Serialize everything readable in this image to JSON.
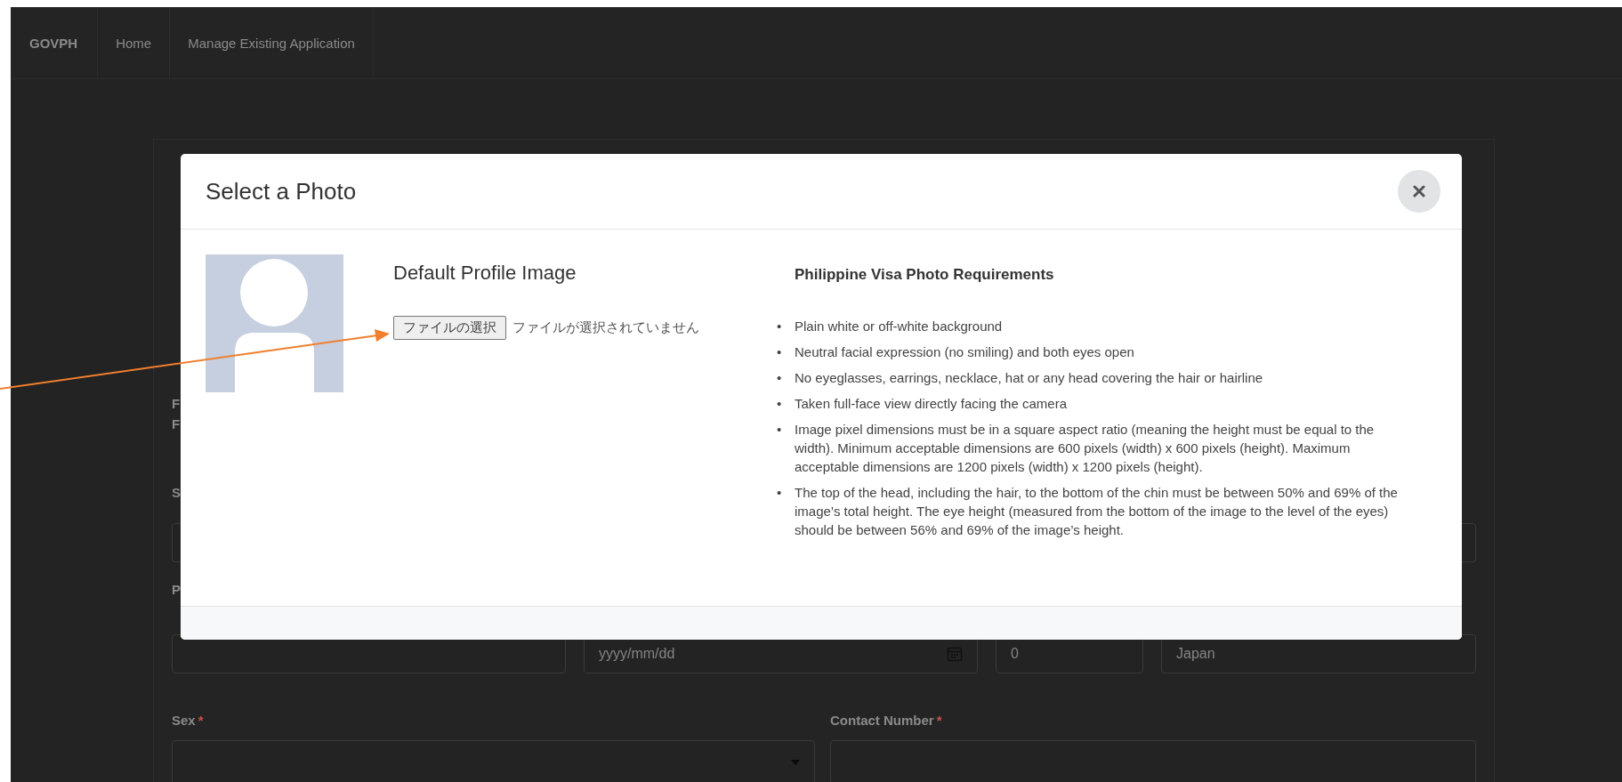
{
  "nav": {
    "brand": "GOVPH",
    "items": [
      {
        "label": "Home"
      },
      {
        "label": "Manage Existing Application"
      }
    ]
  },
  "background_form": {
    "label_fragments": [
      "F",
      "F"
    ],
    "section_fragment": "S",
    "row_label_fragment": "P",
    "date_field": {
      "placeholder": "yyyy/mm/dd"
    },
    "age_field": {
      "value": "0"
    },
    "country_field": {
      "value": "Japan"
    },
    "sex": {
      "label": "Sex",
      "required_mark": "*"
    },
    "contact_number": {
      "label": "Contact Number",
      "required_mark": "*"
    }
  },
  "modal": {
    "title": "Select a Photo",
    "profile_heading": "Default Profile Image",
    "file_input": {
      "button": "ファイルの選択",
      "status": "ファイルが選択されていません"
    },
    "requirements": {
      "title": "Philippine Visa Photo Requirements",
      "bullet": "•",
      "items": [
        "Plain white or off-white background",
        "Neutral facial expression (no smiling) and both eyes open",
        "No eyeglasses, earrings, necklace, hat or any head covering the hair or hairline",
        "Taken full-face view directly facing the camera",
        "Image pixel dimensions must be in a square aspect ratio (meaning the height must be equal to the width). Minimum acceptable dimensions are 600 pixels (width) x 600 pixels (height). Maximum acceptable dimensions are 1200 pixels (width) x 1200 pixels (height).",
        "The top of the head, including the hair, to the bottom of the chin must be between 50% and 69% of the image’s total height. The eye height (measured from the bottom of the image to the level of the eyes) should be between 56% and 69% of the image’s height."
      ]
    }
  }
}
